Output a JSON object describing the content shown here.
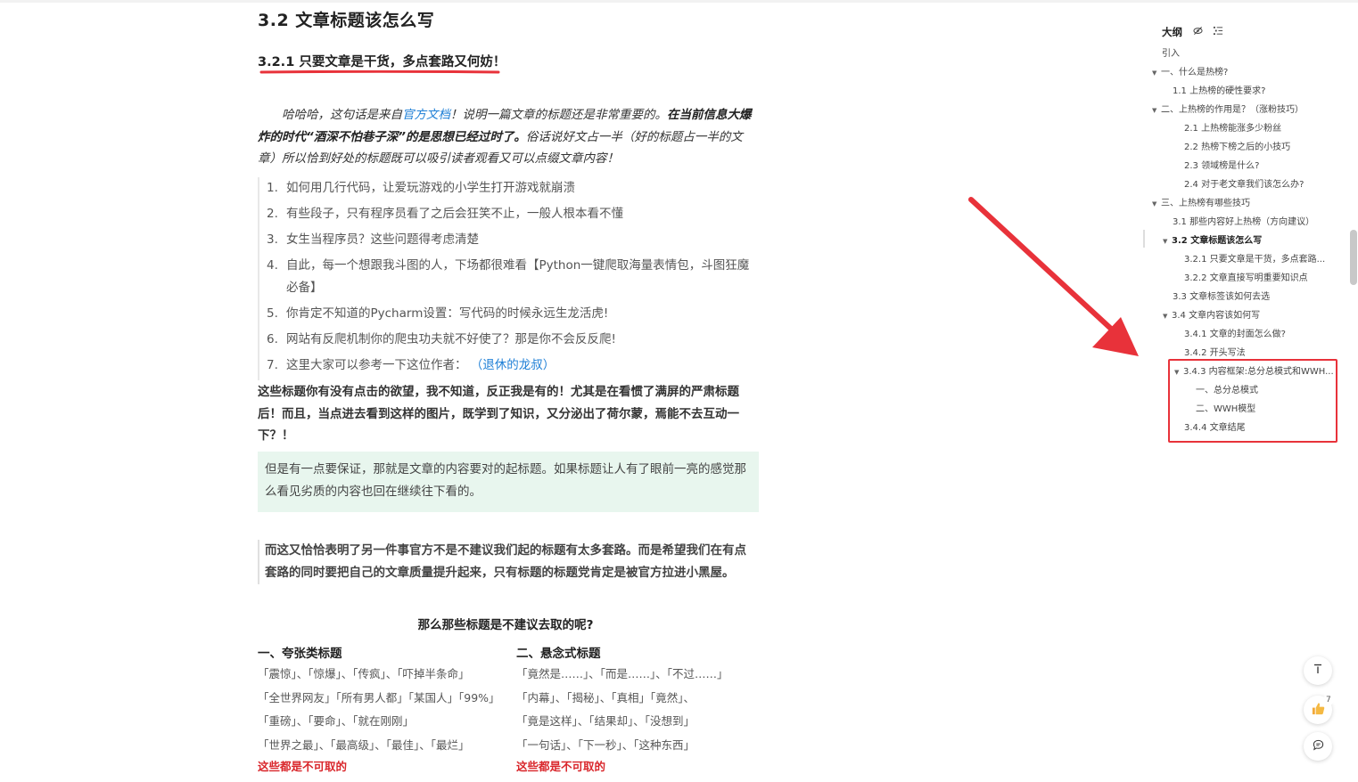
{
  "article": {
    "heading": "3.2  文章标题该怎么写",
    "subheading": "3.2.1 只要文章是干货，多点套路又何妨！",
    "intro": {
      "p1": "哈哈哈，这句话是来自",
      "link": "官方文档",
      "p2": "！说明一篇文章的标题还是非常重要的。",
      "bold": "在当前信息大爆炸的时代“酒深不怕巷子深”的是思想已经过时了。",
      "p3": "俗话说好文占一半（好的标题占一半的文章）所以恰到好处的标题既可以吸引读者观看又可以点缀文章内容！"
    },
    "list": [
      {
        "num": "1.",
        "text": "如何用几行代码，让爱玩游戏的小学生打开游戏就崩溃"
      },
      {
        "num": "2.",
        "text": "有些段子，只有程序员看了之后会狂笑不止，一般人根本看不懂"
      },
      {
        "num": "3.",
        "text": "女生当程序员？这些问题得考虑清楚"
      },
      {
        "num": "4.",
        "text": "自此，每一个想跟我斗图的人，下场都很难看【Python一键爬取海量表情包，斗图狂魔必备】"
      },
      {
        "num": "5.",
        "text": "你肯定不知道的Pycharm设置：写代码的时候永远生龙活虎!"
      },
      {
        "num": "6.",
        "text": "网站有反爬机制你的爬虫功夫就不好使了？那是你不会反反爬!"
      },
      {
        "num": "7.",
        "text": "这里大家可以参考一下这位作者：",
        "link": "（退休的龙叔）"
      }
    ],
    "bold_para": "这些标题你有没有点击的欲望，我不知道，反正我是有的！尤其是在看惯了满屏的严肃标题后！而且，当点进去看到这样的图片，既学到了知识，又分泌出了荷尔蒙，焉能不去互动一下？！",
    "tip": "但是有一点要保证，那就是文章的内容要对的起标题。如果标题让人有了眼前一亮的感觉那么看见劣质的内容也回在继续往下看的。",
    "quote": "而这又恰恰表明了另一件事官方不是不建议我们起的标题有太多套路。而是希望我们在有点套路的同时要把自己的文章质量提升起来，只有标题的标题党肯定是被官方拉进小黑屋。",
    "center_question": "那么那些标题是不建议去取的呢?",
    "col1": {
      "title": "一、夸张类标题",
      "lines": [
        "「震惊」、「惊爆」、「传疯」、「吓掉半条命」",
        "「全世界网友」「所有男人都」「某国人」「99%」",
        "「重磅」、「要命」、「就在刚刚」",
        "「世界之最」、「最高级」、「最佳」、「最烂」"
      ],
      "warn": "这些都是不可取的"
    },
    "col2": {
      "title": "二、悬念式标题",
      "lines": [
        "「竟然是……」、「而是……」、「不过……」",
        "「内幕」、「揭秘」、「真相」「竟然」、",
        "「竟是这样」、「结果却」、「没想到」",
        "「一句话」、「下一秒」、「这种东西」"
      ],
      "warn": "这些都是不可取的"
    }
  },
  "outline": {
    "title": "大纲",
    "icons": [
      "eye-off-icon",
      "list-icon"
    ],
    "items": [
      {
        "label": "引入",
        "caret": ""
      },
      {
        "label": "一、什么是热榜?",
        "caret": "▼"
      },
      {
        "label": "1.1 上热榜的硬性要求?",
        "caret": ""
      },
      {
        "label": "二、上热榜的作用是？（涨粉技巧）",
        "caret": "▼"
      },
      {
        "label": "2.1 上热榜能涨多少粉丝",
        "caret": ""
      },
      {
        "label": "2.2 热榜下榜之后的小技巧",
        "caret": ""
      },
      {
        "label": "2.3 领域榜是什么?",
        "caret": ""
      },
      {
        "label": "2.4 对于老文章我们该怎么办?",
        "caret": ""
      },
      {
        "label": "三、上热榜有哪些技巧",
        "caret": "▼"
      },
      {
        "label": "3.1 那些内容好上热榜（方向建议）",
        "caret": ""
      },
      {
        "label": "3.2 文章标题该怎么写",
        "caret": "▼"
      },
      {
        "label": "3.2.1 只要文章是干货，多点套路...",
        "caret": ""
      },
      {
        "label": "3.2.2 文章直接写明重要知识点",
        "caret": ""
      },
      {
        "label": "3.3 文章标签该如何去选",
        "caret": ""
      },
      {
        "label": "3.4 文章内容该如何写",
        "caret": "▼"
      },
      {
        "label": "3.4.1 文章的封面怎么做?",
        "caret": ""
      },
      {
        "label": "3.4.2 开头写法",
        "caret": ""
      },
      {
        "label": "3.4.3 内容框架:总分总模式和WWH...",
        "caret": "▼"
      },
      {
        "label": "一、总分总模式",
        "caret": ""
      },
      {
        "label": "二、WWH模型",
        "caret": ""
      },
      {
        "label": "3.4.4 文章结尾",
        "caret": ""
      }
    ]
  },
  "floating": {
    "top_icon": "⊤",
    "like_count": "7"
  },
  "colors": {
    "accent_red": "#e8323a",
    "link_blue": "#1e7fd6",
    "tip_bg": "#e8f6ee"
  }
}
